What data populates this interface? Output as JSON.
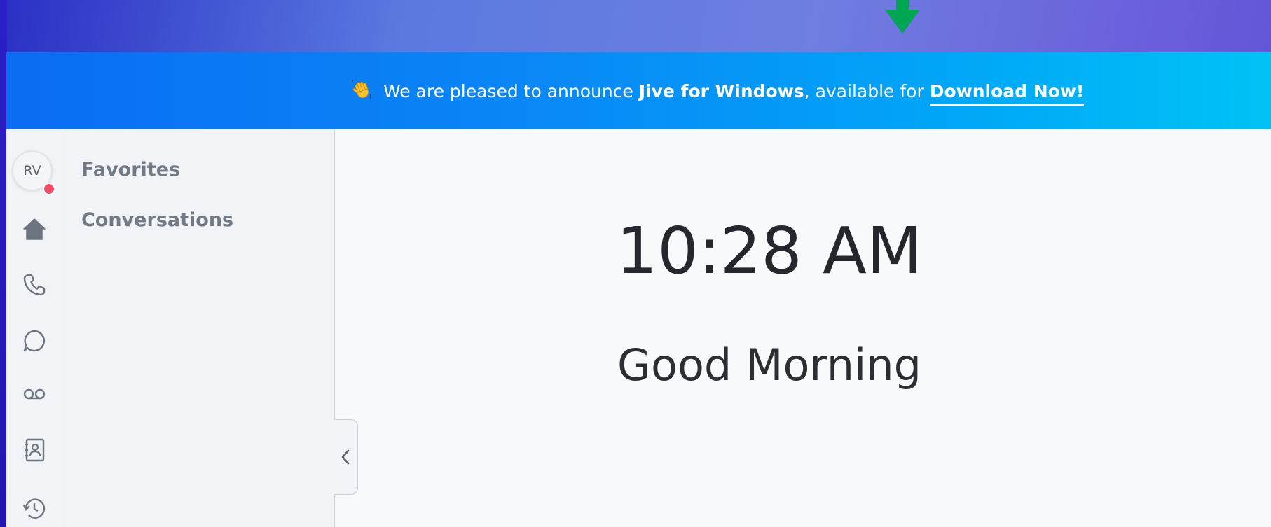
{
  "banner": {
    "text_prefix": " We are pleased to announce ",
    "product": "Jive for Windows",
    "text_middle": ", available for ",
    "link_label": "Download Now!",
    "wave_icon": "waving-hand-icon"
  },
  "annotation": {
    "arrow_color": "#00a651"
  },
  "user": {
    "initials": "RV",
    "presence_color": "#f04c68"
  },
  "rail": {
    "icons": [
      "home-icon",
      "phone-icon",
      "chat-icon",
      "voicemail-icon",
      "contacts-icon",
      "history-icon"
    ]
  },
  "panel": {
    "items": [
      {
        "label": "Favorites"
      },
      {
        "label": "Conversations"
      }
    ]
  },
  "main": {
    "time": "10:28 AM",
    "greeting": "Good Morning"
  },
  "colors": {
    "banner_start": "#0a6df3",
    "banner_end": "#00c3f5",
    "text_dark": "#24282d",
    "panel_text": "#707984"
  }
}
